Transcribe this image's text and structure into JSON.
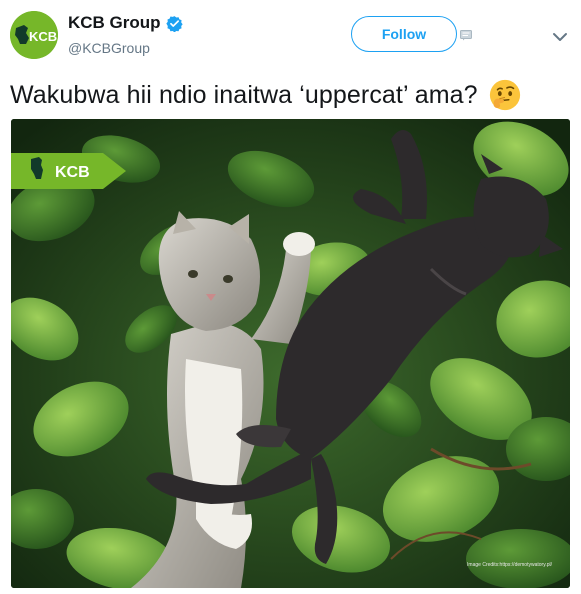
{
  "account": {
    "display_name": "KCB Group",
    "handle": "@KCBGroup",
    "avatar_logo_text": "KCB",
    "verified": true
  },
  "actions": {
    "follow_label": "Follow"
  },
  "icons": {
    "verified": "verified-badge-icon",
    "note": "speech-note-icon",
    "chevron": "chevron-down-icon",
    "emoji": "thinking-face-emoji"
  },
  "tweet": {
    "text": "Wakubwa hii ndio inaitwa ‘uppercat’ ama?"
  },
  "media": {
    "watermark_logo_text": "KCB",
    "credit_text": "Image Credits:https://demotywatory.pl/"
  },
  "colors": {
    "brand_green": "#76b729",
    "twitter_blue": "#1da1f2",
    "text_dark": "#14171a",
    "text_gray": "#657786"
  }
}
